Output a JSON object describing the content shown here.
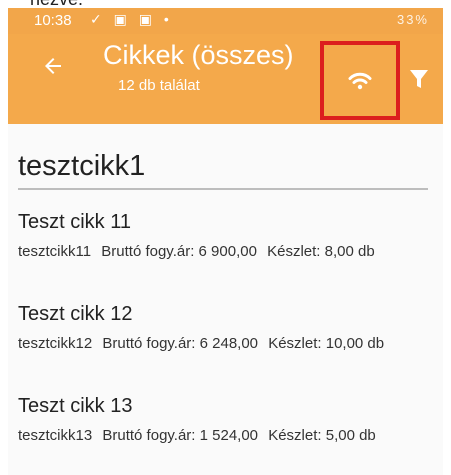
{
  "top_text": "nézve.",
  "statusbar": {
    "time": "10:38",
    "left_icons": "✓ ▣ ▣ •",
    "right_text": "33%"
  },
  "appbar": {
    "title": "Cikkek (összes)",
    "subtitle": "12 db találat",
    "back_icon": "arrow-left-icon",
    "wifi_icon": "wifi-icon",
    "filter_icon": "filter-icon",
    "highlight_color": "#dc1e1e",
    "bar_color": "#f4a94b"
  },
  "search": {
    "value": "tesztcikk1"
  },
  "items": [
    {
      "title": "Teszt cikk 11",
      "code": "tesztcikk11",
      "price": "Bruttó fogy.ár: 6 900,00",
      "stock": "Készlet: 8,00 db"
    },
    {
      "title": "Teszt cikk 12",
      "code": "tesztcikk12",
      "price": "Bruttó fogy.ár: 6 248,00",
      "stock": "Készlet: 10,00 db"
    },
    {
      "title": "Teszt cikk 13",
      "code": "tesztcikk13",
      "price": "Bruttó fogy.ár: 1 524,00",
      "stock": "Készlet: 5,00 db"
    }
  ]
}
